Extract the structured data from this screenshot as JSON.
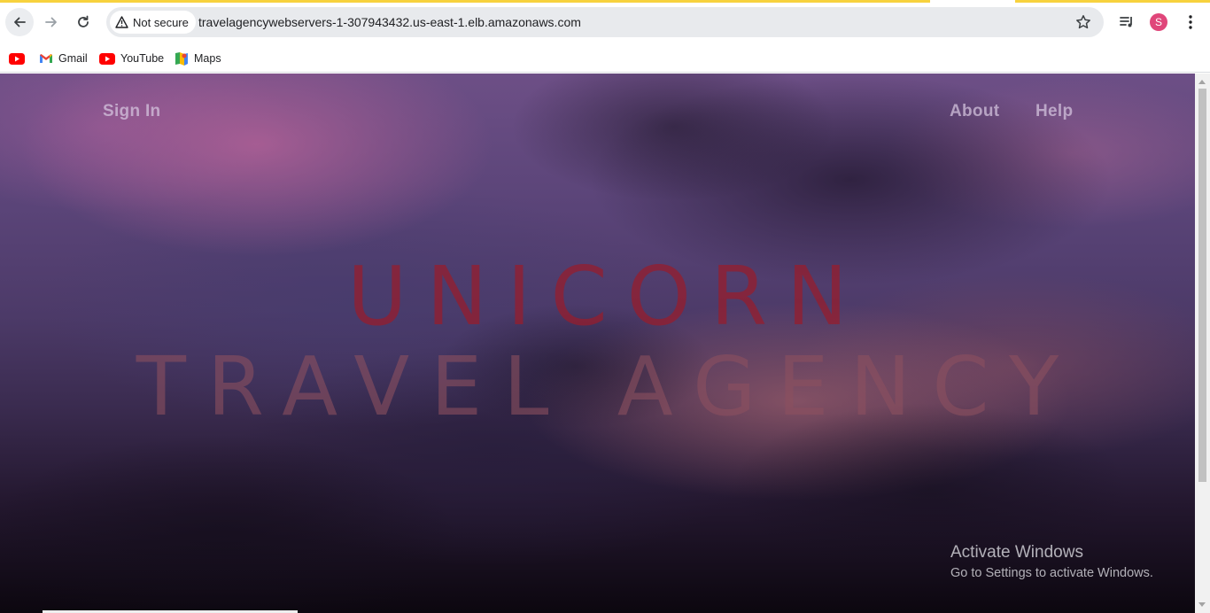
{
  "browser": {
    "security_label": "Not secure",
    "url": "travelagencywebservers-1-307943432.us-east-1.elb.amazonaws.com",
    "profile_initial": "S",
    "accent_color": "#f7d23e",
    "icons": {
      "back": "arrow-left-icon",
      "forward": "arrow-right-icon",
      "reload": "reload-icon",
      "warning": "warning-triangle-icon",
      "bookmark": "star-icon",
      "media": "media-control-icon",
      "menu": "kebab-menu-icon"
    }
  },
  "bookmarks": {
    "items": [
      {
        "label": "",
        "icon": "youtube-icon"
      },
      {
        "label": "Gmail",
        "icon": "gmail-icon"
      },
      {
        "label": "YouTube",
        "icon": "youtube-icon"
      },
      {
        "label": "Maps",
        "icon": "maps-icon"
      }
    ]
  },
  "site": {
    "nav": {
      "sign_in": "Sign In",
      "about": "About",
      "help": "Help"
    },
    "hero": {
      "line1": "UNICORN",
      "line2": "TRAVEL AGENCY"
    }
  },
  "os_overlay": {
    "title": "Activate Windows",
    "subtitle": "Go to Settings to activate Windows."
  }
}
